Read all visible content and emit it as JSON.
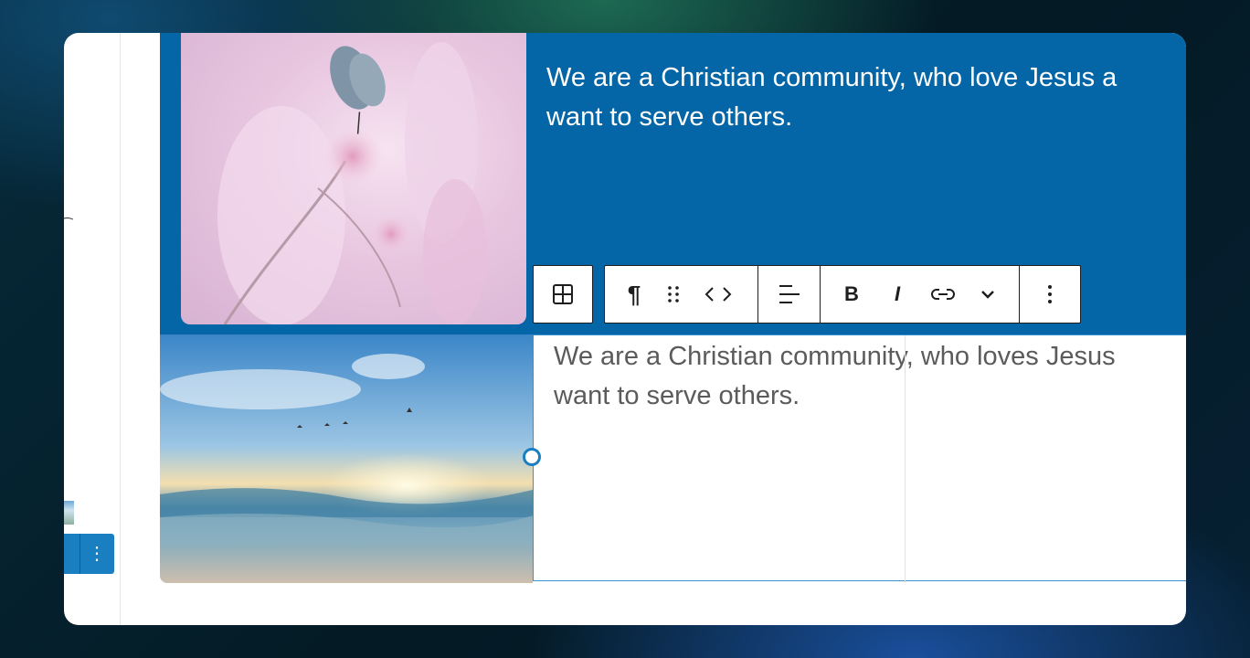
{
  "blocks": {
    "top": {
      "line1": "We are a Christian community, who love Jesus a",
      "line2": "want to serve others."
    },
    "bottom": {
      "line1": "We are a Christian community, who loves Jesus",
      "line2": "want to serve others."
    }
  },
  "toolbar": {
    "layout": "layout-grid-icon",
    "groups": [
      "paragraph-icon",
      "drag-handle-icon",
      "move-arrows-icon",
      "align-icon",
      "bold-icon",
      "italic-icon",
      "link-icon",
      "more-options-chevron-icon",
      "more-vertical-icon"
    ],
    "bold_label": "B",
    "italic_label": "I"
  },
  "colors": {
    "accent": "#0466a6",
    "selection": "#1a7fc1",
    "text_gray": "#5b5b5b"
  }
}
